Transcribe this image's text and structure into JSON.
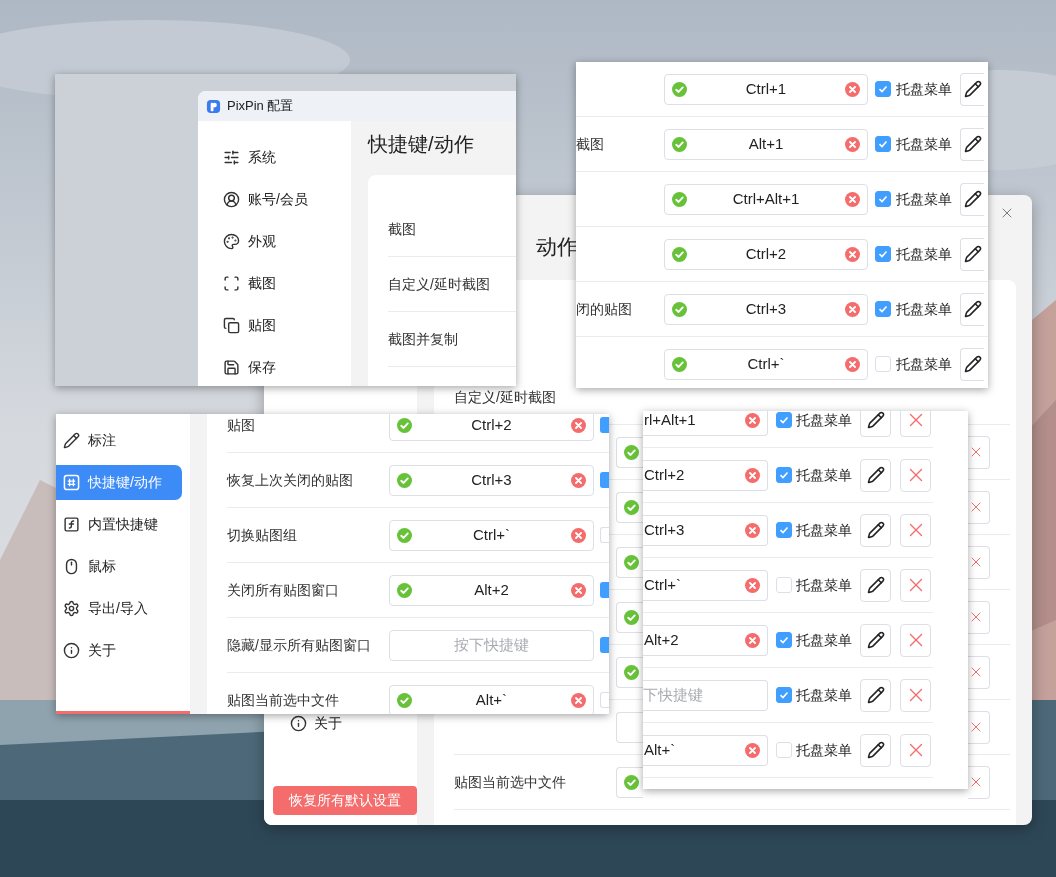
{
  "background_window": {
    "heading": "动作",
    "sidebar_item": "关于",
    "reset_button": "恢复所有默认设置",
    "rows": [
      {
        "label": "自定义/延时截图"
      },
      {
        "valid": true
      },
      {
        "valid": true
      },
      {
        "valid": true
      },
      {
        "valid": true
      },
      {
        "valid": true
      },
      {
        "valid": false
      },
      {
        "label": "贴图当前选中文件",
        "valid": true
      }
    ]
  },
  "top_left_view": {
    "window_title": "PixPin 配置",
    "sidebar": [
      "系统",
      "账号/会员",
      "外观",
      "截图",
      "贴图",
      "保存"
    ],
    "heading": "快捷键/动作",
    "rows": [
      "截图",
      "自定义/延时截图",
      "截图并复制"
    ]
  },
  "top_right_view": {
    "rows": [
      {
        "keys": "Ctrl+1",
        "tray": true,
        "tray_label": "托盘菜单"
      },
      {
        "label": "截图",
        "keys": "Alt+1",
        "tray": true,
        "tray_label": "托盘菜单"
      },
      {
        "keys": "Ctrl+Alt+1",
        "tray": true,
        "tray_label": "托盘菜单"
      },
      {
        "keys": "Ctrl+2",
        "tray": true,
        "tray_label": "托盘菜单"
      },
      {
        "label": "闭的贴图",
        "keys": "Ctrl+3",
        "tray": true,
        "tray_label": "托盘菜单"
      },
      {
        "keys": "Ctrl+`",
        "tray": false,
        "tray_label": "托盘菜单"
      }
    ]
  },
  "bottom_left_view": {
    "sidebar": [
      {
        "label": "标注",
        "selected": false
      },
      {
        "label": "快捷键/动作",
        "selected": true
      },
      {
        "label": "内置快捷键",
        "selected": false
      },
      {
        "label": "鼠标",
        "selected": false
      },
      {
        "label": "导出/导入",
        "selected": false
      },
      {
        "label": "关于",
        "selected": false
      }
    ],
    "rows": [
      {
        "label": "贴图",
        "keys": "Ctrl+2",
        "tray": true
      },
      {
        "label": "恢复上次关闭的贴图",
        "keys": "Ctrl+3",
        "tray": true
      },
      {
        "label": "切换贴图组",
        "keys": "Ctrl+`",
        "tray": false
      },
      {
        "label": "关闭所有贴图窗口",
        "keys": "Alt+2",
        "tray": true
      },
      {
        "label": "隐藏/显示所有贴图窗口",
        "placeholder": "按下快捷键",
        "tray": true
      },
      {
        "label": "贴图当前选中文件",
        "keys": "Alt+`",
        "tray": false
      }
    ]
  },
  "bottom_right_view": {
    "rows": [
      {
        "keys": "rl+Alt+1",
        "tray": true,
        "tray_label": "托盘菜单"
      },
      {
        "keys": "Ctrl+2",
        "tray": true,
        "tray_label": "托盘菜单"
      },
      {
        "keys": "Ctrl+3",
        "tray": true,
        "tray_label": "托盘菜单"
      },
      {
        "keys": "Ctrl+`",
        "tray": false,
        "tray_label": "托盘菜单"
      },
      {
        "keys": "Alt+2",
        "tray": true,
        "tray_label": "托盘菜单"
      },
      {
        "placeholder": "下快捷键",
        "tray": true,
        "tray_label": "托盘菜单"
      },
      {
        "keys": "Alt+`",
        "tray": false,
        "tray_label": "托盘菜单"
      }
    ]
  }
}
